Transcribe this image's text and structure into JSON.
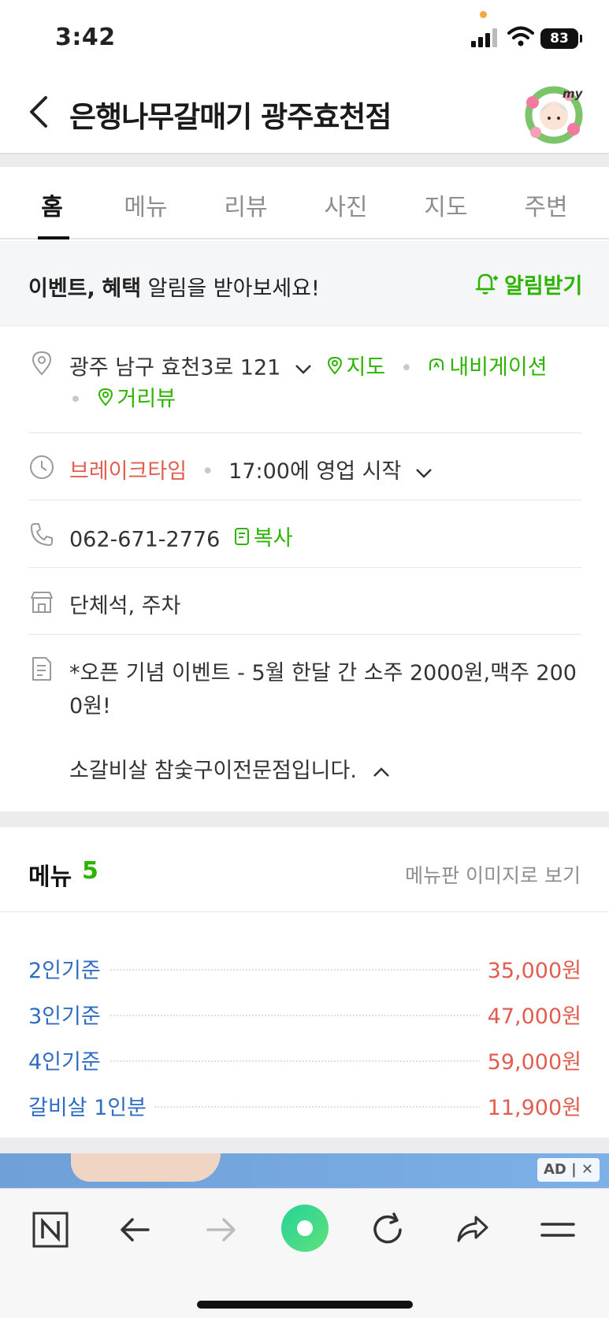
{
  "status": {
    "time": "3:42",
    "battery": "83"
  },
  "header": {
    "title": "은행나무갈매기 광주효천점",
    "avatar_label": "my"
  },
  "tabs": [
    {
      "label": "홈"
    },
    {
      "label": "메뉴"
    },
    {
      "label": "리뷰"
    },
    {
      "label": "사진"
    },
    {
      "label": "지도"
    },
    {
      "label": "주변"
    }
  ],
  "event": {
    "bold1": "이벤트,",
    "bold2": "혜택",
    "rest": "알림을 받아보세요!",
    "button": "알림받기"
  },
  "info": {
    "address": "광주 남구 효천3로 121",
    "map_link": "지도",
    "navi_link": "내비게이션",
    "street_link": "거리뷰",
    "hours_status": "브레이크타임",
    "hours_detail": "17:00에 영업 시작",
    "phone": "062-671-2776",
    "copy": "복사",
    "facilities": "단체석, 주차",
    "desc_line1": "*오픈 기념 이벤트 - 5월 한달 간 소주 2000원,맥주 200",
    "desc_line2": "0원!",
    "desc_line3": "소갈비살 참숯구이전문점입니다."
  },
  "menu": {
    "title": "메뉴",
    "count": "5",
    "image_link": "메뉴판 이미지로 보기",
    "items": [
      {
        "name": "2인기준",
        "price": "35,000원"
      },
      {
        "name": "3인기준",
        "price": "47,000원"
      },
      {
        "name": "4인기준",
        "price": "59,000원"
      },
      {
        "name": "갈비살 1인분",
        "price": "11,900원"
      }
    ]
  },
  "ad": {
    "badge": "AD | ✕"
  },
  "colors": {
    "accent_green": "#2db400",
    "price_red": "#e25d4f",
    "menu_blue": "#2f6cc4"
  }
}
